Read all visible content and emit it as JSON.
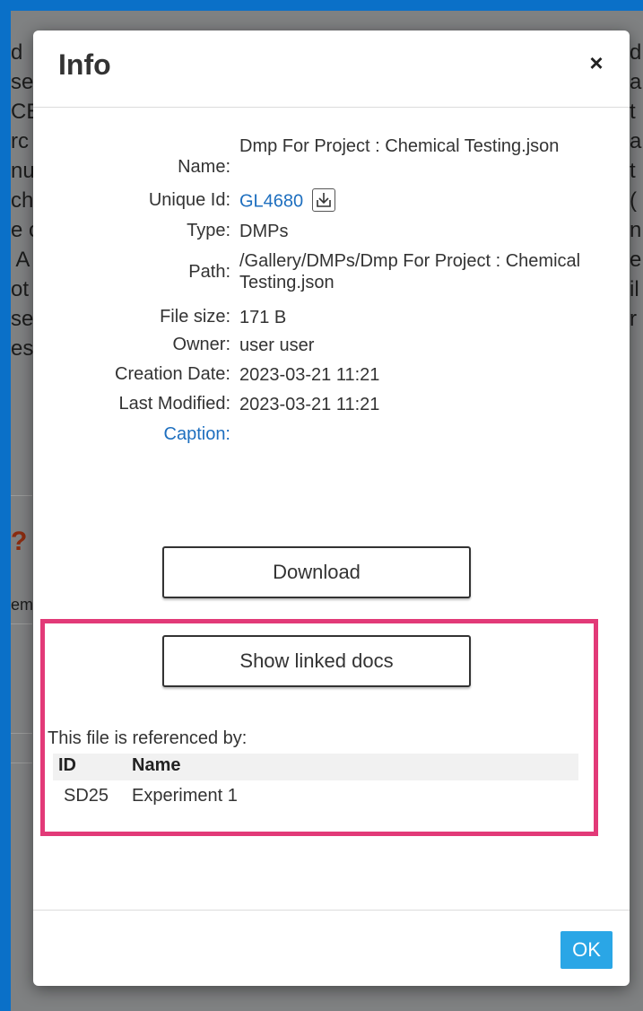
{
  "background": {
    "left_text": [
      "d",
      "se",
      "CE",
      "rc",
      "nu",
      "ch",
      "e c",
      " A",
      "ot",
      "se",
      "es"
    ],
    "right_text": [
      "d",
      "a",
      "t",
      "a",
      "t",
      "(",
      "n",
      "e",
      "il",
      "r"
    ],
    "question_mark": "?",
    "em_text": "em"
  },
  "modal": {
    "title": "Info",
    "close_glyph": "×",
    "fields": {
      "name_label": "Name:",
      "name_value": "Dmp For Project : Chemical Testing.json",
      "unique_id_label": "Unique Id:",
      "unique_id_value": "GL4680",
      "type_label": "Type:",
      "type_value": "DMPs",
      "path_label": "Path:",
      "path_value": "/Gallery/DMPs/Dmp For Project : Chemical Testing.json",
      "file_size_label": "File size:",
      "file_size_value": "171 B",
      "owner_label": "Owner:",
      "owner_value": "user user",
      "creation_date_label": "Creation Date:",
      "creation_date_value": "2023-03-21 11:21",
      "last_modified_label": "Last Modified:",
      "last_modified_value": "2023-03-21 11:21",
      "caption_label": "Caption:"
    },
    "download_label": "Download",
    "show_linked_label": "Show linked docs",
    "referenced_title": "This file is referenced by:",
    "ref_table": {
      "headers": {
        "id": "ID",
        "name": "Name"
      },
      "rows": [
        {
          "id": "SD25",
          "name": "Experiment 1"
        }
      ]
    },
    "ok_label": "OK"
  },
  "colors": {
    "page_bg": "#0a70c8",
    "link": "#1e6fbf",
    "highlight_border": "#e23a78",
    "ok_button": "#2aa6e6"
  },
  "icons": {
    "close": "close-icon",
    "download_id": "download-icon"
  }
}
